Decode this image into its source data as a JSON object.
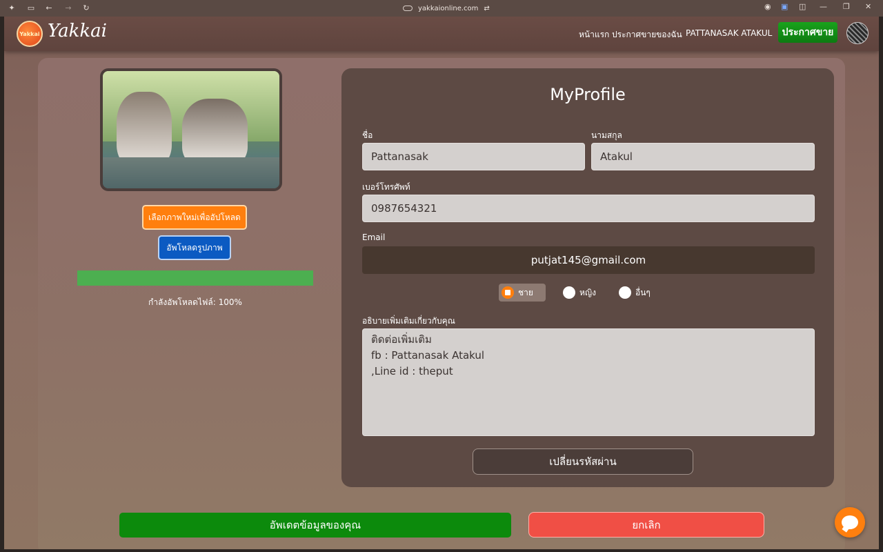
{
  "browser": {
    "url": "yakkaionline.com"
  },
  "nav": {
    "brand": "Yakkai",
    "logo_text": "Yakkai",
    "links": [
      "หน้าแรก",
      "ประกาศขายของฉัน",
      "PATTANASAK ATAKUL"
    ],
    "cta": "ประกาศขาย"
  },
  "left": {
    "choose_button": "เลือกภาพใหม่เพื่ออัปโหลด",
    "upload_button": "อัพโหลดรูปภาพ",
    "progress_percent": 100,
    "progress_text": "กำลังอัพโหลดไฟล์: 100%"
  },
  "form": {
    "title": "MyProfile",
    "first_name_label": "ชื่อ",
    "first_name_value": "Pattanasak",
    "last_name_label": "นามสกุล",
    "last_name_value": "Atakul",
    "phone_label": "เบอร์โทรศัพท์",
    "phone_value": "0987654321",
    "email_label": "Email",
    "email_value": "putjat145@gmail.com",
    "gender_options": [
      "ชาย",
      "หญิง",
      "อื่นๆ"
    ],
    "gender_selected": "ชาย",
    "about_label": "อธิบายเพิ่มเติมเกี่ยวกับคุณ",
    "about_lines": [
      "ติดต่อเพิ่มเติม",
      "fb : Pattanasak Atakul",
      ",Line id : theput"
    ],
    "change_password": "เปลี่ยนรหัสผ่าน"
  },
  "actions": {
    "update": "อัพเดตข้อมูลของคุณ",
    "cancel": "ยกเลิก"
  },
  "colors": {
    "accent_orange": "#ff7f0e",
    "cta_green": "#0c8a0c",
    "cancel_red": "#f04f45",
    "upload_blue": "#0b5ac2"
  }
}
